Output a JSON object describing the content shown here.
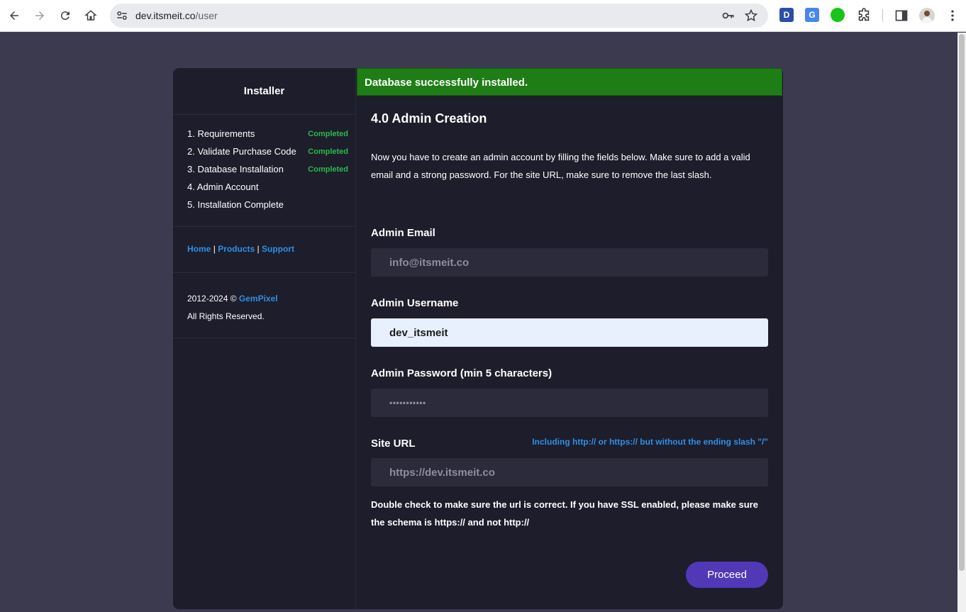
{
  "browser": {
    "url_host": "dev.itsmeit.co",
    "url_path": "/user",
    "extensions": [
      {
        "name": "dashlane-extension-icon",
        "label": "D",
        "color": "#2b4fa6"
      },
      {
        "name": "google-translate-extension-icon",
        "label": "G",
        "color": "#4a86e8"
      },
      {
        "name": "green-extension-icon",
        "label": "",
        "color": "#19c419"
      }
    ]
  },
  "sidebar": {
    "title": "Installer",
    "steps": [
      {
        "label": "1. Requirements",
        "status": "Completed"
      },
      {
        "label": "2. Validate Purchase Code",
        "status": "Completed"
      },
      {
        "label": "3. Database Installation",
        "status": "Completed"
      },
      {
        "label": "4. Admin Account",
        "status": ""
      },
      {
        "label": "5. Installation Complete",
        "status": ""
      }
    ],
    "links": {
      "home": "Home",
      "separator": "|",
      "products": "Products",
      "support": "Support"
    },
    "copyright_prefix": "2012-2024 ©",
    "copyright_brand": "GemPixel",
    "rights": "All Rights Reserved."
  },
  "main": {
    "alert": "Database successfully installed.",
    "title": "4.0 Admin Creation",
    "intro": "Now you have to create an admin account by filling the fields below. Make sure to add a valid email and a strong password. For the site URL, make sure to remove the last slash.",
    "email_label": "Admin Email",
    "email_placeholder": "info@itsmeit.co",
    "username_label": "Admin Username",
    "username_value": "dev_itsmeit",
    "password_label": "Admin Password (min 5 characters)",
    "password_value": "•••••••••••",
    "siteurl_label": "Site URL",
    "siteurl_hint": "Including http:// or https:// but without the ending slash \"/\"",
    "siteurl_placeholder": "https://dev.itsmeit.co",
    "warning": "Double check to make sure the url is correct. If you have SSL enabled, please make sure the schema is https:// and not http://",
    "proceed_label": "Proceed"
  },
  "colors": {
    "page_bg": "#3b3a4f",
    "card_bg": "#1e1d2b",
    "success": "#1f7d16",
    "status_completed": "#2ab94a",
    "link": "#2e8fe6",
    "button": "#5138b6"
  }
}
